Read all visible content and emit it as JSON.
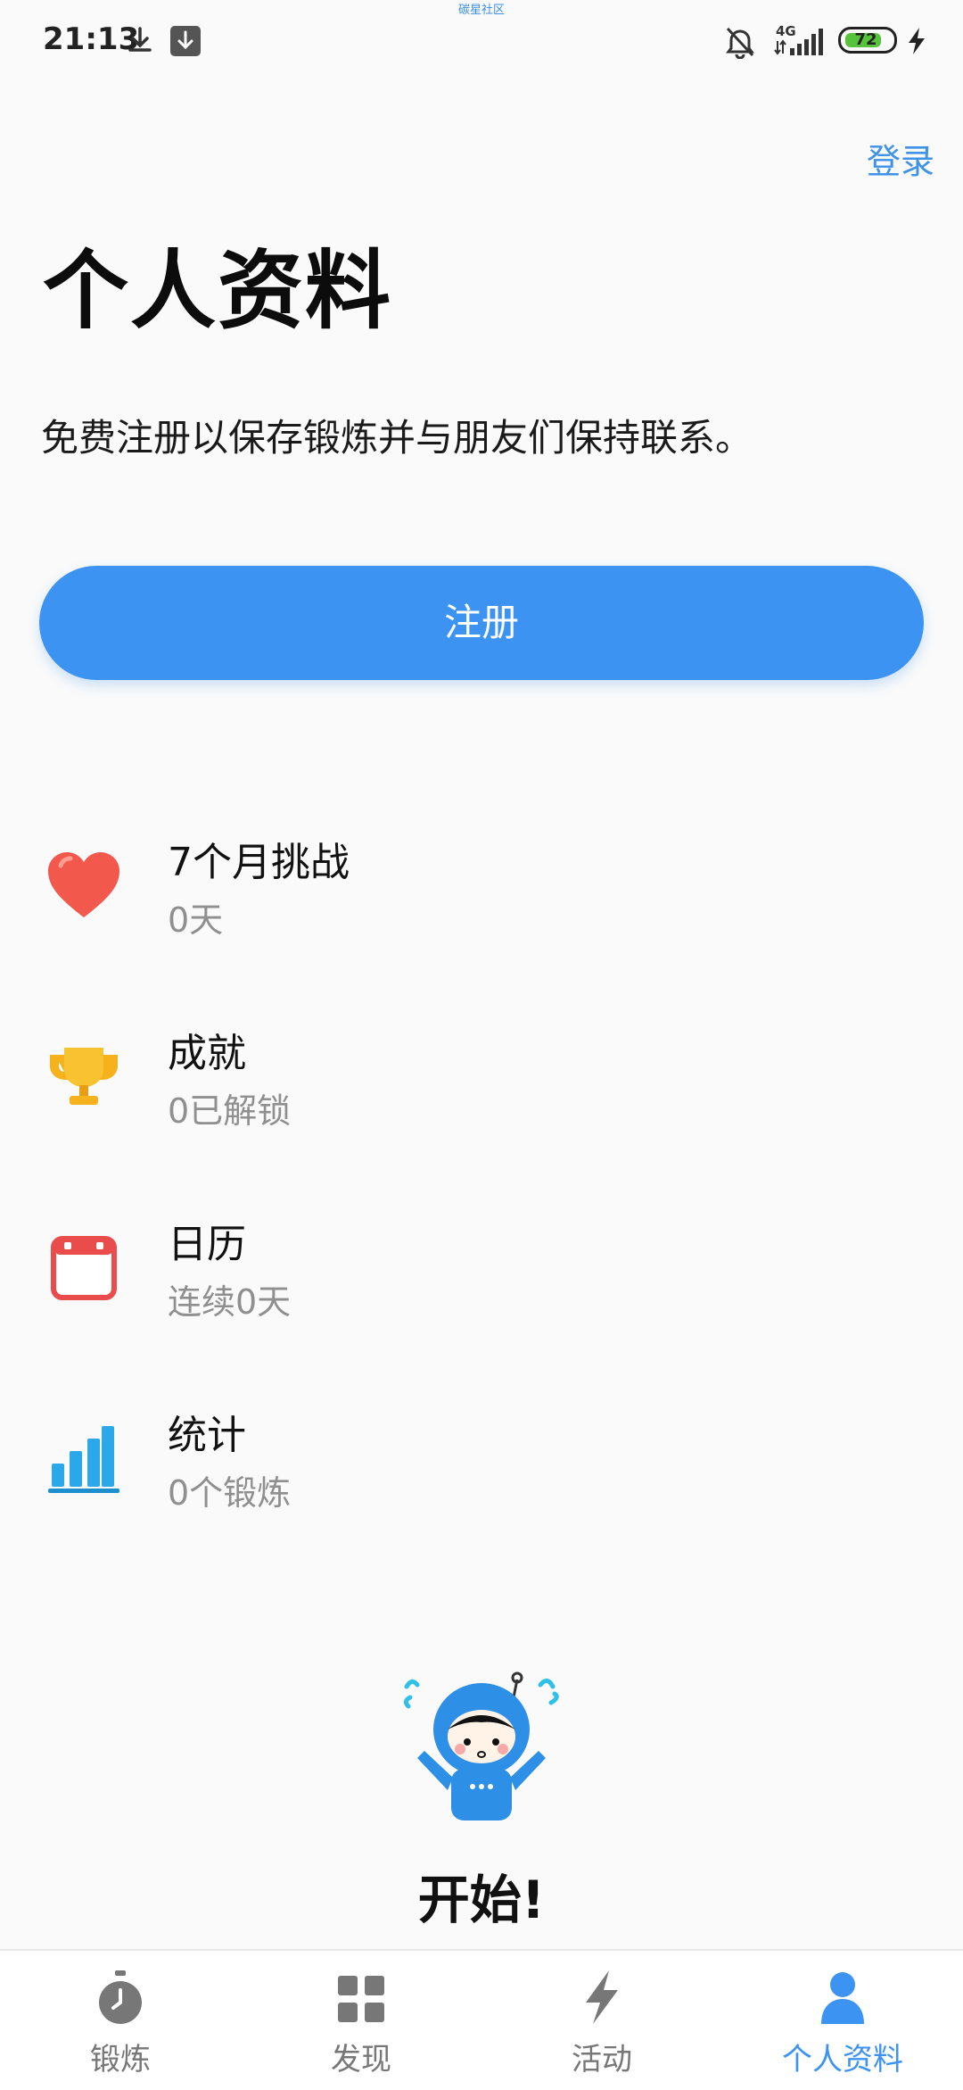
{
  "status_bar": {
    "time": "21:13",
    "network": "4G",
    "battery": "72",
    "top_tag": "碳星社区",
    "icons": [
      "download-icon",
      "download-box-icon",
      "mute-bell-icon",
      "signal-icon",
      "battery-icon",
      "charging-icon"
    ]
  },
  "header": {
    "login_label": "登录",
    "title": "个人资料"
  },
  "intro": {
    "text": "免费注册以保存锻炼并与朋友们保持联系。"
  },
  "register_button": {
    "label": "注册"
  },
  "menu": [
    {
      "title": "7个月挑战",
      "subtitle": "0天",
      "icon": "heart-icon"
    },
    {
      "title": "成就",
      "subtitle": "0已解锁",
      "icon": "trophy-icon"
    },
    {
      "title": "日历",
      "subtitle": "连续0天",
      "icon": "calendar-icon"
    },
    {
      "title": "统计",
      "subtitle": "0个锻炼",
      "icon": "bar-chart-icon"
    }
  ],
  "start": {
    "label": "开始!",
    "icon": "mascot-icon"
  },
  "bottom_nav": [
    {
      "label": "锻炼",
      "icon": "stopwatch-icon",
      "active": false
    },
    {
      "label": "发现",
      "icon": "grid-icon",
      "active": false
    },
    {
      "label": "活动",
      "icon": "lightning-icon",
      "active": false
    },
    {
      "label": "个人资料",
      "icon": "person-icon",
      "active": true
    }
  ],
  "colors": {
    "accent": "#3d93f2",
    "heart": "#f2584b",
    "trophy": "#f6b21c",
    "calendar": "#ea4b4b",
    "chart": "#2aa8e8"
  }
}
